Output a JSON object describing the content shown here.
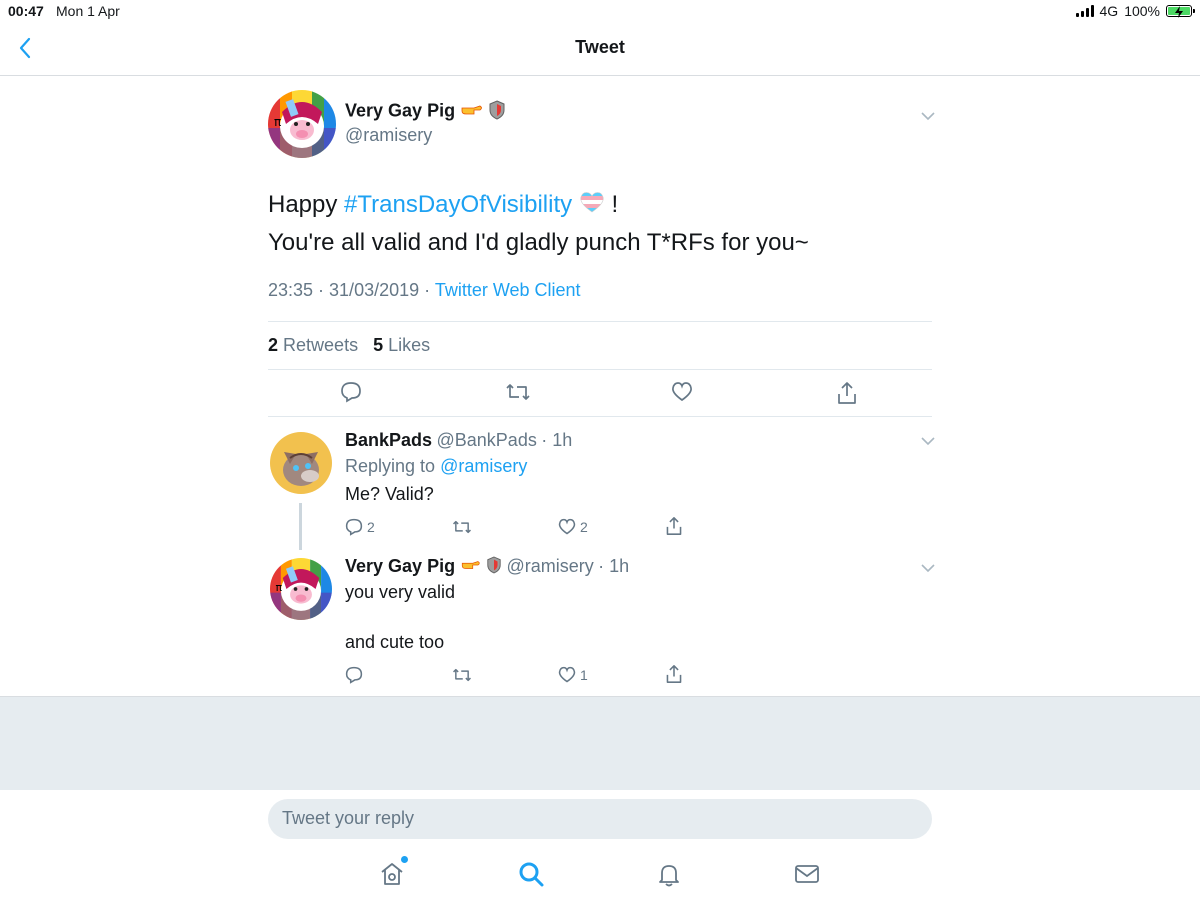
{
  "status_bar": {
    "time": "00:47",
    "date": "Mon 1 Apr",
    "network": "4G",
    "battery": "100%",
    "battery_level": 1.0
  },
  "nav": {
    "title": "Tweet",
    "back_icon": "chevron-left-icon"
  },
  "main_tweet": {
    "author_name": "Very Gay Pig",
    "author_handle": "@ramisery",
    "text_prefix": "Happy ",
    "hashtag": "#TransDayOfVisibility",
    "text_suffix": " !",
    "text_line2": "You're all valid and I'd gladly punch T*RFs for you~",
    "timestamp": "23:35 · 31/03/2019 · ",
    "client": "Twitter Web Client",
    "retweets_count": "2",
    "retweets_label": "Retweets",
    "likes_count": "5",
    "likes_label": "Likes"
  },
  "replies": [
    {
      "author_name": "BankPads",
      "author_handle": "@BankPads",
      "time": "· 1h",
      "replying_label": "Replying to ",
      "replying_to": "@ramisery",
      "text": "Me? Valid?",
      "reply_count": "2",
      "retweet_count": "",
      "like_count": "2"
    },
    {
      "author_name": "Very Gay Pig",
      "author_handle": "@ramisery",
      "time": "· 1h",
      "text_line1": "you very valid",
      "text_line2": "and cute too",
      "reply_count": "",
      "retweet_count": "",
      "like_count": "1"
    }
  ],
  "compose": {
    "placeholder": "Tweet your reply"
  },
  "colors": {
    "accent": "#1da1f2",
    "secondary_text": "#657786",
    "divider": "#e1e8ed",
    "background_gray": "#e6ecf0"
  }
}
